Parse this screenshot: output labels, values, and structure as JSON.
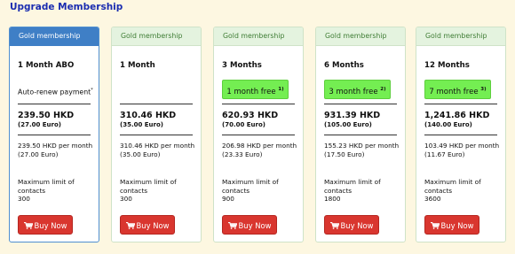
{
  "page": {
    "title": "Upgrade Membership"
  },
  "colors": {
    "title": "#1a2db0",
    "selected_header": "#3f7fc6",
    "header": "#e4f3df",
    "free_badge": "#74ee52",
    "buy_button": "#d9362f"
  },
  "cards": [
    {
      "header": "Gold membership",
      "duration": "1 Month ABO",
      "auto_renew": "Auto-renew payment",
      "auto_renew_mark": "*",
      "free_text": "",
      "free_sup": "",
      "price": "239.50 HKD",
      "price_euro": "(27.00 Euro)",
      "per_month_hkd": "239.50 HKD per month",
      "per_month_euro": "(27.00 Euro)",
      "contacts_label_1": "Maximum limit of",
      "contacts_label_2": "contacts",
      "contacts_value": "300",
      "buy_label": "Buy Now"
    },
    {
      "header": "Gold membership",
      "duration": "1 Month",
      "auto_renew": "",
      "auto_renew_mark": "",
      "free_text": "",
      "free_sup": "",
      "price": "310.46 HKD",
      "price_euro": "(35.00 Euro)",
      "per_month_hkd": "310.46 HKD per month",
      "per_month_euro": "(35.00 Euro)",
      "contacts_label_1": "Maximum limit of",
      "contacts_label_2": "contacts",
      "contacts_value": "300",
      "buy_label": "Buy Now"
    },
    {
      "header": "Gold membership",
      "duration": "3 Months",
      "auto_renew": "",
      "auto_renew_mark": "",
      "free_text": "1 month free",
      "free_sup": "1)",
      "price": "620.93 HKD",
      "price_euro": "(70.00 Euro)",
      "per_month_hkd": "206.98 HKD per month",
      "per_month_euro": "(23.33 Euro)",
      "contacts_label_1": "Maximum limit of",
      "contacts_label_2": "contacts",
      "contacts_value": "900",
      "buy_label": "Buy Now"
    },
    {
      "header": "Gold membership",
      "duration": "6 Months",
      "auto_renew": "",
      "auto_renew_mark": "",
      "free_text": "3 month free",
      "free_sup": "2)",
      "price": "931.39 HKD",
      "price_euro": "(105.00 Euro)",
      "per_month_hkd": "155.23 HKD per month",
      "per_month_euro": "(17.50 Euro)",
      "contacts_label_1": "Maximum limit of",
      "contacts_label_2": "contacts",
      "contacts_value": "1800",
      "buy_label": "Buy Now"
    },
    {
      "header": "Gold membership",
      "duration": "12 Months",
      "auto_renew": "",
      "auto_renew_mark": "",
      "free_text": "7 month free",
      "free_sup": "3)",
      "price": "1,241.86 HKD",
      "price_euro": "(140.00 Euro)",
      "per_month_hkd": "103.49 HKD per month",
      "per_month_euro": "(11.67 Euro)",
      "contacts_label_1": "Maximum limit of",
      "contacts_label_2": "contacts",
      "contacts_value": "3600",
      "buy_label": "Buy Now"
    }
  ]
}
